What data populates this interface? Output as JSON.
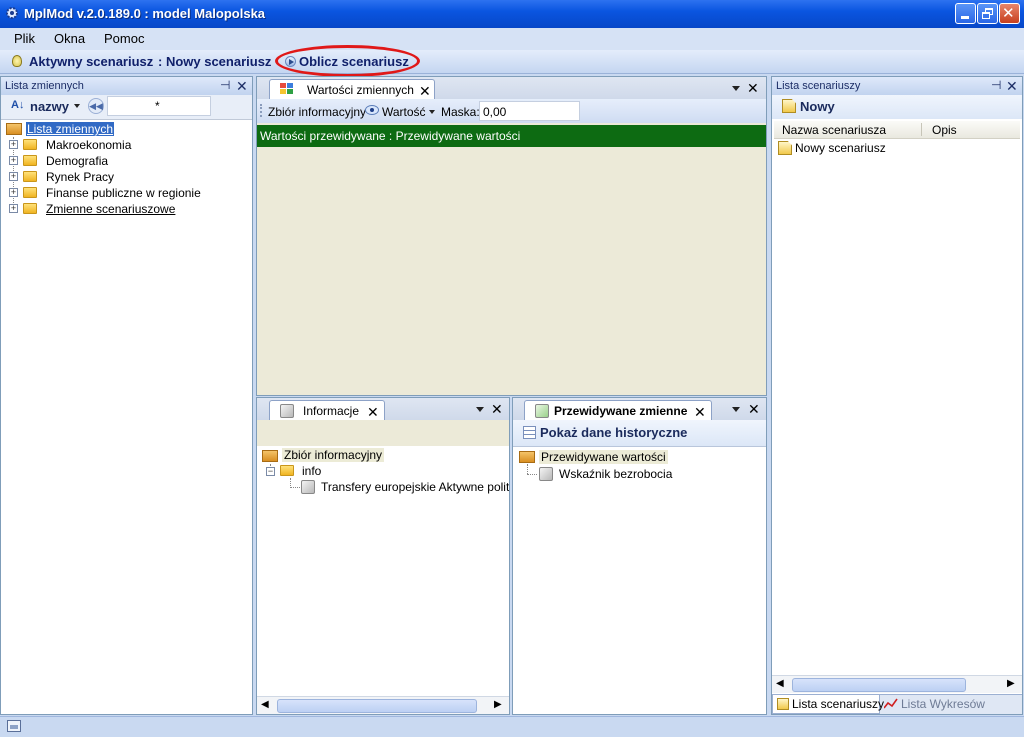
{
  "window": {
    "title": "MplMod v.2.0.189.0 : model Malopolska"
  },
  "menu": {
    "items": [
      "Plik",
      "Okna",
      "Pomoc"
    ]
  },
  "toolbar": {
    "active_label": "Aktywny scenariusz",
    "active_value": ": Nowy scenariusz",
    "compute_label": "Oblicz scenariusz"
  },
  "left_panel": {
    "title": "Lista zmiennych",
    "sort_label": "nazwy",
    "search_value": "*",
    "tree_root": "Lista zmiennych",
    "tree_items": [
      "Makroekonomia",
      "Demografia",
      "Rynek Pracy",
      "Finanse publiczne w regionie",
      "Zmienne scenariuszowe"
    ]
  },
  "center_top": {
    "tab_label": "Wartości zmiennych",
    "toolbar": {
      "set_label": "Zbiór informacyjny",
      "value_label": "Wartość",
      "mask_label": "Maska:",
      "mask_value": "0,00"
    },
    "green_bar_text": "Wartości przewidywane : Przewidywane wartości"
  },
  "info_panel": {
    "tab_label": "Informacje",
    "root": "Zbiór informacyjny",
    "child": "info",
    "leaf": "Transfery europejskie Aktywne polityki r"
  },
  "predicted_panel": {
    "tab_label": "Przewidywane zmienne",
    "show_history_label": "Pokaż dane historyczne",
    "root": "Przewidywane wartości",
    "leaf": "Wskaźnik bezrobocia"
  },
  "right_panel": {
    "title": "Lista scenariuszy",
    "new_label": "Nowy",
    "columns": [
      "Nazwa scenariusza",
      "Opis"
    ],
    "rows": [
      "Nowy scenariusz"
    ],
    "bottom_tabs": [
      "Lista scenariuszy",
      "Lista Wykresów"
    ]
  },
  "colors": {
    "accent_green": "#0d6b12",
    "highlight_red": "#e01818",
    "title_blue": "#0a55e0"
  }
}
